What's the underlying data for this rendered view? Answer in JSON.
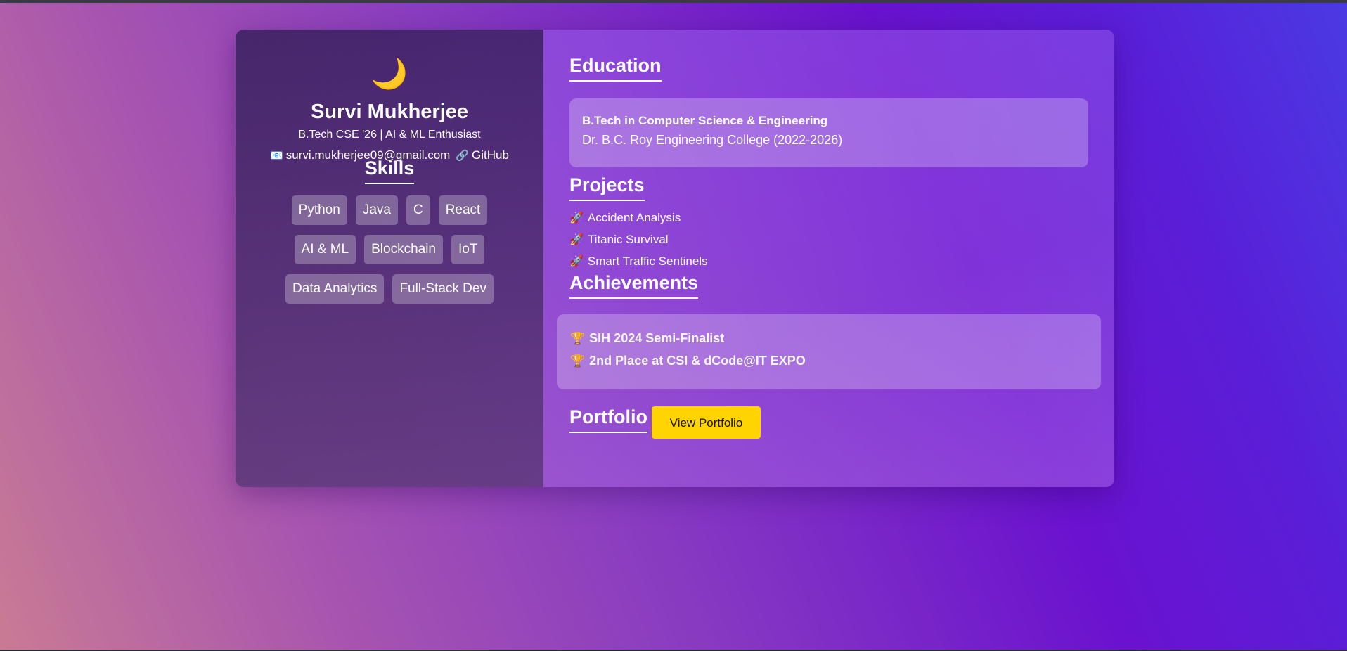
{
  "profile": {
    "icon": "🌙",
    "name": "Survi Mukherjee",
    "tagline": "B.Tech CSE '26 | AI & ML Enthusiast",
    "email_icon": "📧",
    "email": "survi.mukherjee09@gmail.com",
    "github_icon": "🔗",
    "github_label": "GitHub"
  },
  "skills": {
    "heading": "Skills",
    "items": [
      "Python",
      "Java",
      "C",
      "React",
      "AI & ML",
      "Blockchain",
      "IoT",
      "Data Analytics",
      "Full-Stack Dev"
    ]
  },
  "education": {
    "heading": "Education",
    "degree": "B.Tech in Computer Science & Engineering",
    "school": "Dr. B.C. Roy Engineering College (2022-2026)"
  },
  "projects": {
    "heading": "Projects",
    "icon": "🚀",
    "items": [
      "Accident Analysis",
      "Titanic Survival",
      "Smart Traffic Sentinels"
    ]
  },
  "achievements": {
    "heading": "Achievements",
    "icon": "🏆",
    "items": [
      "SIH 2024 Semi-Finalist",
      "2nd Place at CSI & dCode@IT EXPO"
    ]
  },
  "portfolio": {
    "heading": "Portfolio",
    "button_label": "View Portfolio"
  },
  "colors": {
    "accent_button": "#ffd400"
  }
}
